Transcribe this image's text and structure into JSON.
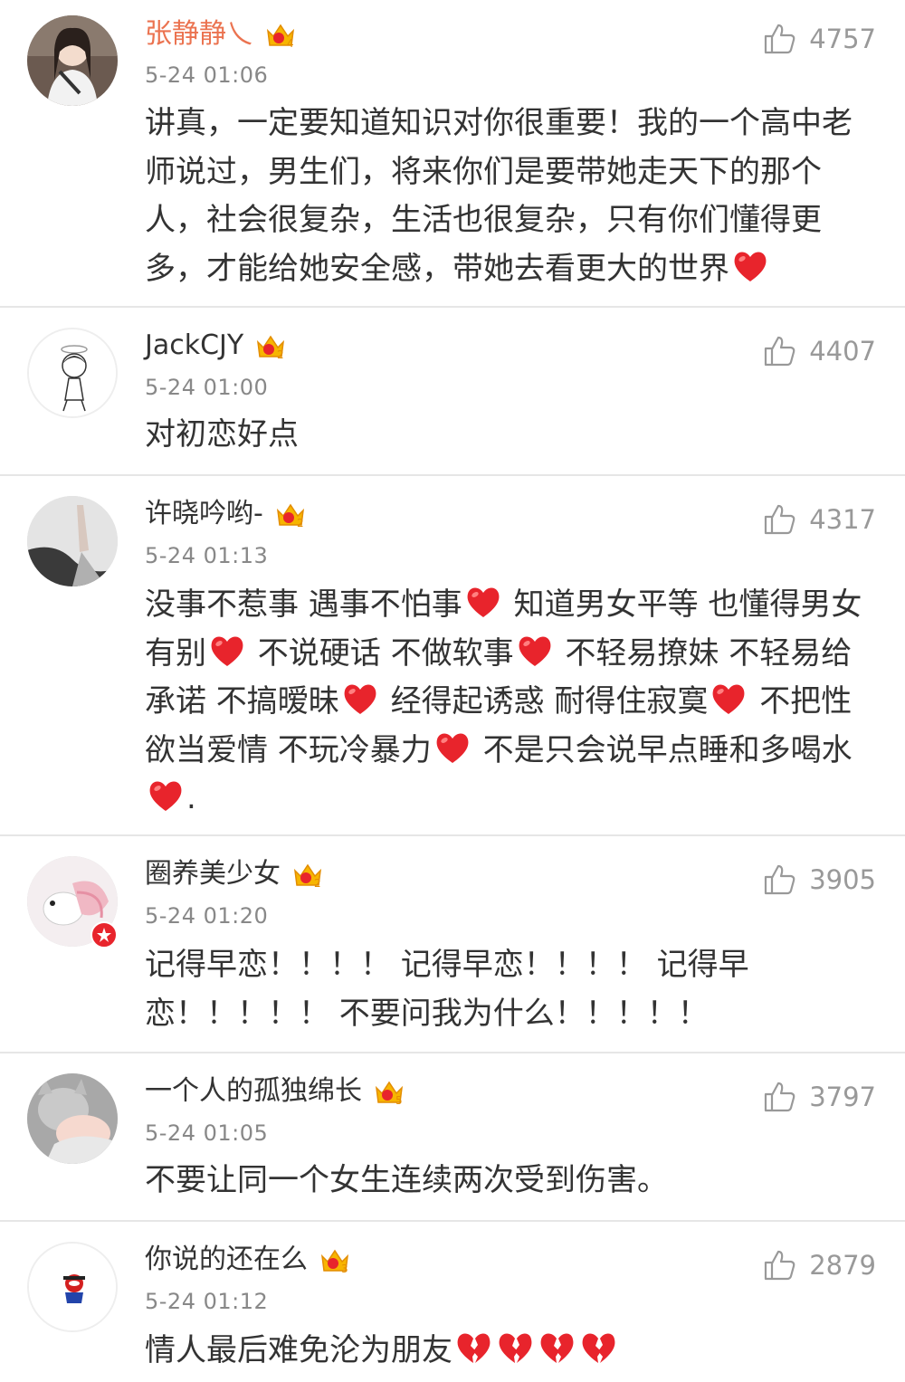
{
  "colors": {
    "vip_name": "#eb7350",
    "text": "#333333",
    "meta": "#888888",
    "like": "#999999",
    "heart": "#e8242c"
  },
  "comments": [
    {
      "username": "张静静乀",
      "time": "5-24 01:06",
      "likes": "4757",
      "vip_level": "4",
      "text_parts": [
        "讲真，一定要知道知识对你很重要！我的一个高中老师说过，男生们，将来你们是要带她走天下的那个人，社会很复杂，生活也很复杂，只有你们懂得更多，才能给她安全感，带她去看更大的世界"
      ],
      "emojis": [
        "red-heart"
      ]
    },
    {
      "username": "JackCJY",
      "time": "5-24 01:00",
      "likes": "4407",
      "vip_level": "2",
      "text_parts": [
        "对初恋好点"
      ]
    },
    {
      "username": "许晓吟哟-",
      "time": "5-24 01:13",
      "likes": "4317",
      "vip_level": "2",
      "text_parts": [
        "没事不惹事 遇事不怕事",
        " 知道男女平等 也懂得男女有别",
        " 不说硬话 不做软事",
        " 不轻易撩妹 不轻易给承诺 不搞暧昧",
        " 经得起诱惑 耐得住寂寞",
        " 不把性欲当爱情 不玩冷暴力",
        " 不是只会说早点睡和多喝水",
        "."
      ]
    },
    {
      "username": "圈养美少女",
      "time": "5-24 01:20",
      "likes": "3905",
      "vip_level": "2",
      "text_parts": [
        "记得早恋！！！！ 记得早恋！！！！ 记得早恋！！！！！ 不要问我为什么！！！！！"
      ]
    },
    {
      "username": "一个人的孤独绵长",
      "time": "5-24 01:05",
      "likes": "3797",
      "vip_level": "5",
      "text_parts": [
        "不要让同一个女生连续两次受到伤害。"
      ]
    },
    {
      "username": "你说的还在么",
      "time": "5-24 01:12",
      "likes": "2879",
      "vip_level": "3",
      "text_parts": [
        "情人最后难免沦为朋友"
      ]
    }
  ]
}
